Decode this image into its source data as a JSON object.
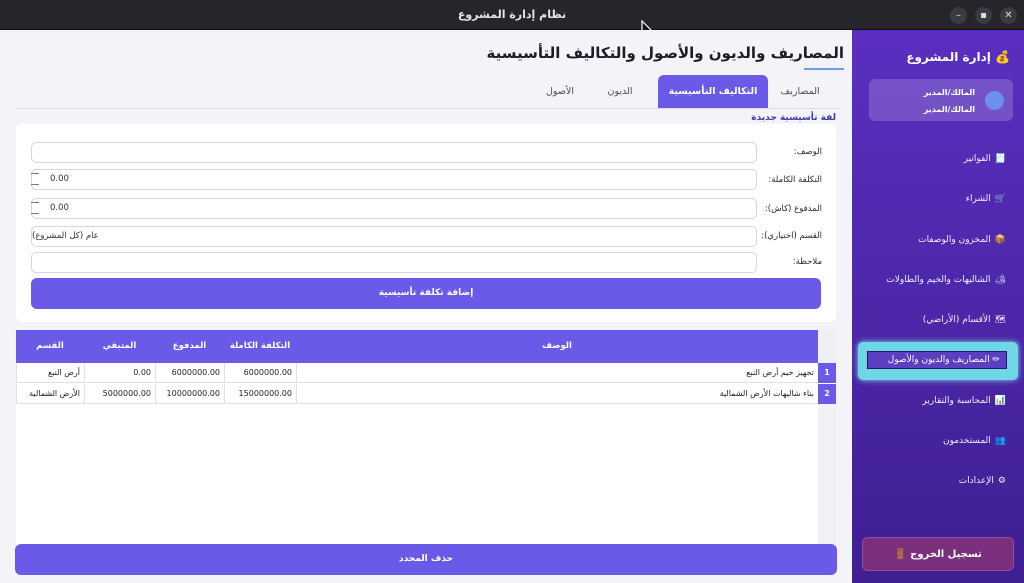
{
  "window": {
    "title": "نظام إدارة المشروع"
  },
  "sidebar": {
    "app_title": "💰 إدارة المشروع",
    "user_line1": "المالك/المدير",
    "user_line2": "المالك/المدير",
    "items": [
      {
        "icon": "🧾",
        "label": "الفواتير"
      },
      {
        "icon": "🛒",
        "label": "الشراء"
      },
      {
        "icon": "📦",
        "label": "المخزون والوصفات"
      },
      {
        "icon": "🏕",
        "label": "الشاليهات والخيم والطاولات"
      },
      {
        "icon": "🗺",
        "label": "الأقسام (الأراضي)"
      },
      {
        "icon": "✏",
        "label": "المصاريف والديون والأصول"
      },
      {
        "icon": "📊",
        "label": "المحاسبة والتقارير"
      },
      {
        "icon": "👥",
        "label": "المستخدمون"
      },
      {
        "icon": "⚙",
        "label": "الإعدادات"
      }
    ],
    "logout_label": "تسجيل الخروج 🚪"
  },
  "page": {
    "title": "المصاريف والديون والأصول والتكاليف التأسيسية",
    "tabs": [
      "المصاريف",
      "التكاليف التأسيسية",
      "الديون",
      "الأصول"
    ],
    "active_tab": 1
  },
  "form": {
    "section_title": "لفة تأسيسية جديدة",
    "fields": {
      "description": {
        "label": "الوصف:",
        "value": ""
      },
      "total_cost": {
        "label": "التكلفة الكاملة:",
        "value": "0.00"
      },
      "paid_cash": {
        "label": "المدفوع (كاش):",
        "value": "0.00"
      },
      "section": {
        "label": "القسم (اختياري):",
        "value": "عام (كل المشروع)"
      },
      "note": {
        "label": "ملاحظة:",
        "value": ""
      }
    },
    "add_button": "إضافة تكلفة تأسيسية"
  },
  "table": {
    "columns": [
      "الوصف",
      "التكلفة الكاملة",
      "المدفوع",
      "المتبقي",
      "القسم"
    ],
    "rows": [
      {
        "num": "1",
        "description": "تجهيز خيم أرض النبع",
        "total": "6000000.00",
        "paid": "6000000.00",
        "remaining": "0.00",
        "section": "أرض النبع"
      },
      {
        "num": "2",
        "description": "بناء شاليهات الأرض الشمالية",
        "total": "15000000.00",
        "paid": "10000000.00",
        "remaining": "5000000.00",
        "section": "الأرض الشمالية"
      }
    ]
  },
  "delete_button": "حذف المحدد",
  "colors": {
    "accent": "#6a5ae8",
    "sidebar": "#4a26a8",
    "logout": "#7a2f7d",
    "active_nav_glow": "#6fd6e6"
  }
}
